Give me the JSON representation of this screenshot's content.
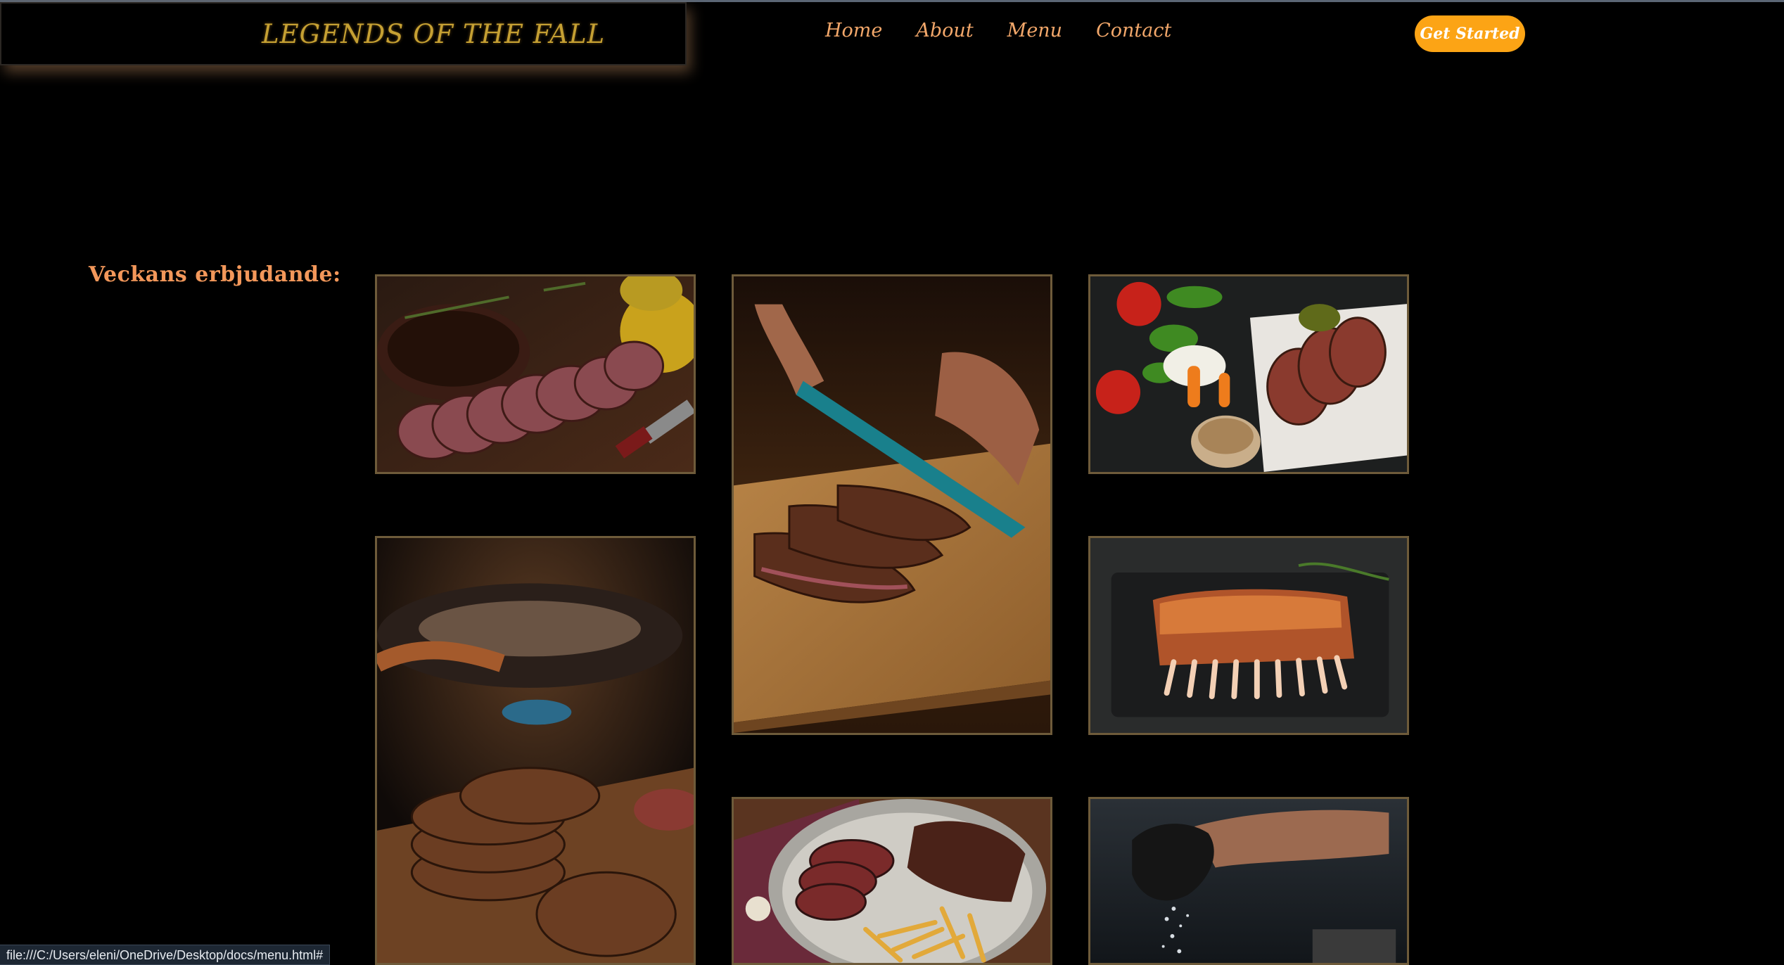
{
  "header": {
    "brand": "LEGENDS OF THE FALL",
    "nav": [
      "Home",
      "About",
      "Menu",
      "Contact"
    ],
    "cta_label": "Get Started"
  },
  "main": {
    "heading": "Veckans erbjudande:",
    "gallery": [
      {
        "icon": "sliced-steak-rosemary-photo"
      },
      {
        "icon": "knife-slicing-steak-photo"
      },
      {
        "icon": "steak-with-vegetables-photo"
      },
      {
        "icon": "grilled-burger-patties-photo"
      },
      {
        "icon": "rack-of-ribs-photo"
      },
      {
        "icon": "steak-with-fries-plate-photo"
      },
      {
        "icon": "seasoning-with-salt-photo"
      }
    ]
  },
  "status_bar": {
    "url": "file:///C:/Users/eleni/OneDrive/Desktop/docs/menu.html#"
  },
  "colors": {
    "brand": "#c5a033",
    "nav": "#f2a76a",
    "cta": "#fca415",
    "heading": "#f2975a",
    "tile_border": "#6e5b3a"
  }
}
